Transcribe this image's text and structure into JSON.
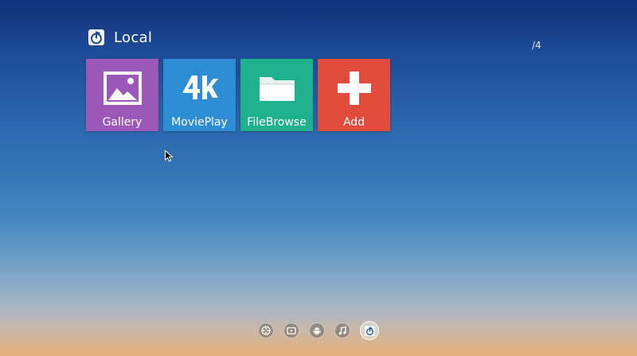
{
  "header": {
    "title": "Local",
    "icon": "local-music-icon"
  },
  "page_indicator": "/4",
  "tiles": [
    {
      "label": "Gallery",
      "icon": "image-icon",
      "color": "#9b58b8"
    },
    {
      "label": "MoviePlay",
      "icon": "4k-icon",
      "color": "#2f8dd6"
    },
    {
      "label": "FileBrowse",
      "icon": "folder-icon",
      "color": "#1fb08c"
    },
    {
      "label": "Add",
      "icon": "plus-icon",
      "color": "#e34b3b"
    }
  ],
  "dock": [
    {
      "icon": "film-reel-icon",
      "active": false
    },
    {
      "icon": "tv-icon",
      "active": false
    },
    {
      "icon": "android-icon",
      "active": false
    },
    {
      "icon": "music-note-icon",
      "active": false
    },
    {
      "icon": "local-music-icon",
      "active": true
    }
  ]
}
